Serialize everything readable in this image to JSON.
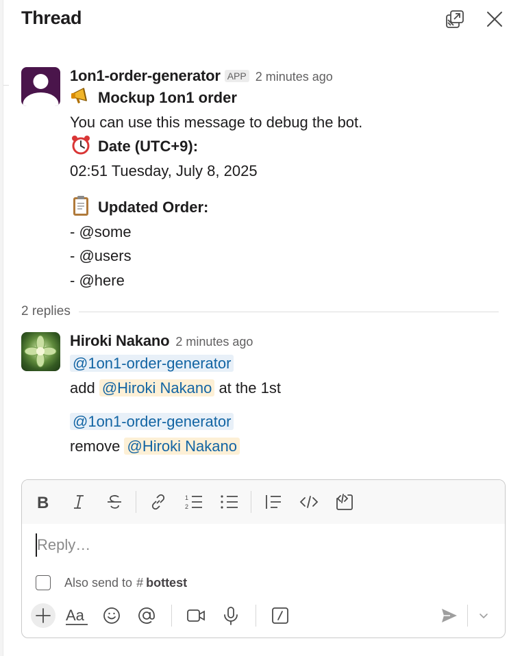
{
  "thread": {
    "title": "Thread",
    "icons": {
      "popout": "popout-window-icon",
      "close": "close-icon"
    }
  },
  "parent_message": {
    "sender": "1on1-order-generator",
    "badge": "APP",
    "time": "2 minutes ago",
    "avatar": "default-avatar-icon",
    "heading": "Mockup 1on1 order",
    "heading_emoji": "megaphone-icon",
    "description": "You can use this message to debug the bot.",
    "date_label": "Date (UTC+9):",
    "date_emoji": "alarm-clock-icon",
    "date_value": "02:51 Tuesday, July 8, 2025",
    "order_label": "Updated Order:",
    "order_emoji": "clipboard-icon",
    "order_items": [
      "- @some",
      "- @users",
      "- @here"
    ]
  },
  "replies_label": "2 replies",
  "reply": {
    "sender": "Hiroki Nakano",
    "time": "2 minutes ago",
    "avatar": "flower-photo-avatar",
    "lines": [
      {
        "mention": "@1on1-order-generator"
      },
      {
        "prefix": "add ",
        "mention": "@Hiroki Nakano",
        "suffix": " at the 1st"
      },
      {
        "mention": "@1on1-order-generator"
      },
      {
        "prefix": "remove ",
        "mention": "@Hiroki Nakano"
      }
    ]
  },
  "composer": {
    "placeholder": "Reply…",
    "also_send_prefix": "Also send to",
    "channel_hash": "#",
    "channel_name": "bottest",
    "toolbar_icons": [
      "bold-icon",
      "italic-icon",
      "strikethrough-icon",
      "link-icon",
      "ordered-list-icon",
      "bulleted-list-icon",
      "blockquote-icon",
      "code-icon",
      "code-block-icon"
    ],
    "bottom_icons": [
      "plus-icon",
      "formatting-icon",
      "emoji-icon",
      "mention-icon",
      "video-icon",
      "microphone-icon",
      "shortcuts-icon",
      "send-icon",
      "send-options-chevron-icon"
    ]
  },
  "colors": {
    "link": "#1264a3",
    "mention_app_bg": "#e8f0f8",
    "mention_self_bg": "#fdf0d6",
    "bot_avatar": "#4a154b"
  }
}
